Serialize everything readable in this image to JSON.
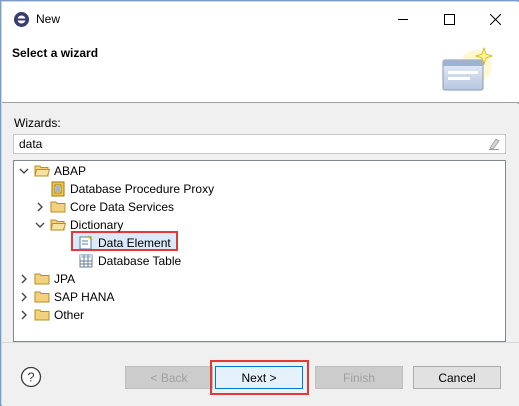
{
  "window": {
    "title": "New"
  },
  "banner": {
    "title": "Select a wizard"
  },
  "filter": {
    "label": "Wizards:",
    "value": "data"
  },
  "tree": {
    "abap": "ABAP",
    "db_proc_proxy": "Database Procedure Proxy",
    "core_data_services": "Core Data Services",
    "dictionary": "Dictionary",
    "data_element": "Data Element",
    "database_table": "Database Table",
    "jpa": "JPA",
    "sap_hana": "SAP HANA",
    "other": "Other"
  },
  "buttons": {
    "help": "?",
    "back": "< Back",
    "next": "Next >",
    "finish": "Finish",
    "cancel": "Cancel"
  },
  "colors": {
    "highlight_border": "#e53935",
    "selection_bg": "#dbe9f9",
    "folder_yellow": "#e8c24c"
  }
}
